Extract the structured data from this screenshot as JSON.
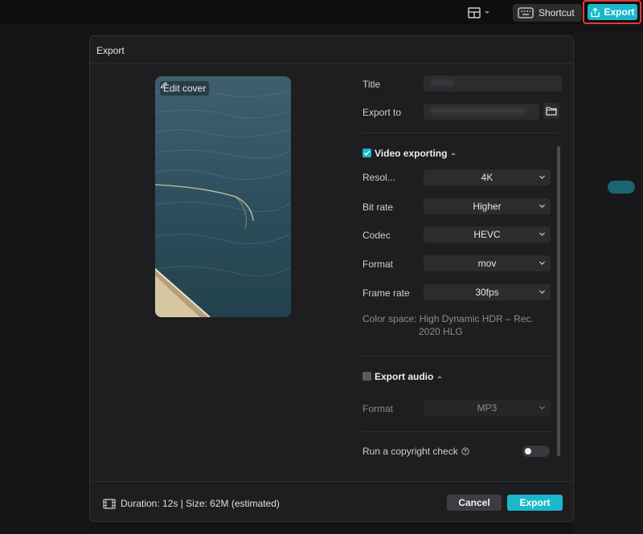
{
  "topbar": {
    "layout_icon": "layout-grid-icon",
    "shortcut_label": "Shortcut",
    "shortcut_icon": "keyboard-icon",
    "export_label": "Export",
    "export_icon": "upload-icon",
    "accent_color": "#1bb8cc",
    "highlight_color": "#e53935"
  },
  "dialog": {
    "title": "Export",
    "cover": {
      "edit_label": "Edit cover",
      "edit_icon": "pencil-icon"
    },
    "fields": {
      "title_label": "Title",
      "title_value": "",
      "export_to_label": "Export to",
      "export_to_value": "",
      "folder_icon": "folder-icon"
    },
    "video": {
      "section_label": "Video exporting",
      "enabled": true,
      "rows": [
        {
          "label": "Resol...",
          "value": "4K"
        },
        {
          "label": "Bit rate",
          "value": "Higher"
        },
        {
          "label": "Codec",
          "value": "HEVC"
        },
        {
          "label": "Format",
          "value": "mov"
        },
        {
          "label": "Frame rate",
          "value": "30fps"
        }
      ],
      "color_space_line1": "Color space: High Dynamic HDR – Rec.",
      "color_space_line2": "2020 HLG"
    },
    "audio": {
      "section_label": "Export audio",
      "enabled": false,
      "format_label": "Format",
      "format_value": "MP3"
    },
    "copyright": {
      "label": "Run a copyright check",
      "help_icon": "help-circle-icon",
      "enabled": false
    },
    "footer": {
      "film_icon": "film-icon",
      "info": "Duration: 12s | Size: 62M (estimated)",
      "cancel_label": "Cancel",
      "export_label": "Export"
    }
  }
}
